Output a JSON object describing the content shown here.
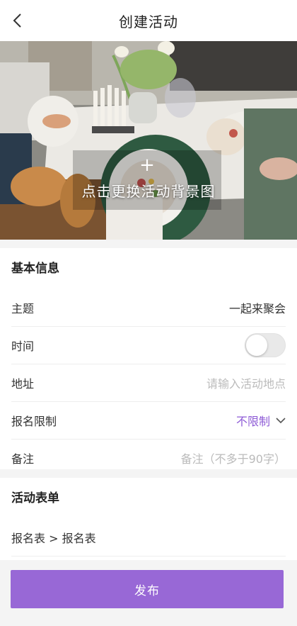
{
  "nav": {
    "back_icon": "chevron-left-icon",
    "title": "创建活动"
  },
  "cover": {
    "plus": "+",
    "hint": "点击更换活动背景图"
  },
  "basic": {
    "title": "基本信息",
    "topic_label": "主题",
    "topic_value": "一起来聚会",
    "time_label": "时间",
    "time_toggle_on": false,
    "address_label": "地址",
    "address_placeholder": "请输入活动地点",
    "limit_label": "报名限制",
    "limit_value": "不限制",
    "remark_label": "备注",
    "remark_placeholder": "备注（不多于90字）"
  },
  "form": {
    "title": "活动表单",
    "signup_path": "报名表 > 报名表"
  },
  "publish_label": "发布",
  "colors": {
    "accent": "#9868d6",
    "accent_text": "#8e5bd6"
  }
}
